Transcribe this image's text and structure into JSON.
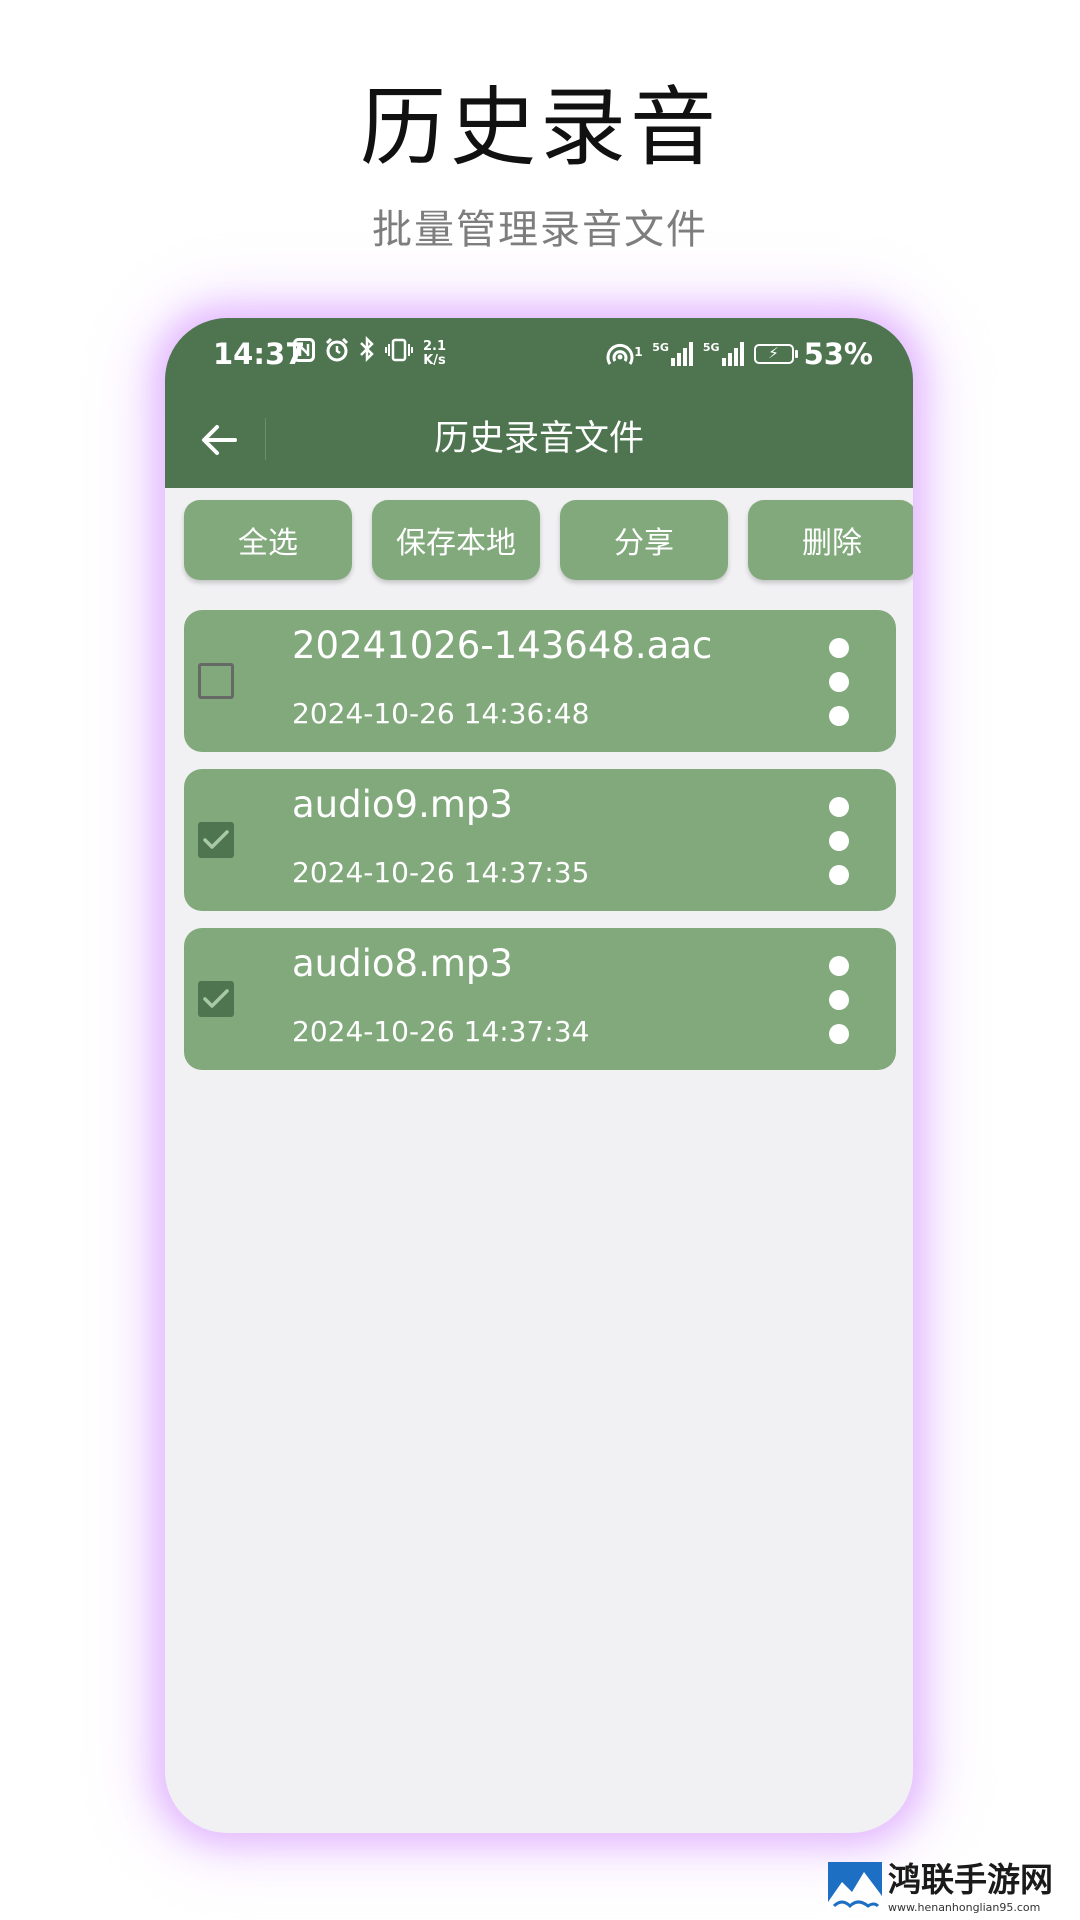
{
  "promo": {
    "title": "历史录音",
    "subtitle": "批量管理录音文件"
  },
  "status_bar": {
    "time": "14:37",
    "net_speed_value": "2.1",
    "net_speed_unit": "K/s",
    "left_icons": [
      "nfc-icon",
      "alarm-icon",
      "bluetooth-icon",
      "vibrate-icon"
    ],
    "hotspot_badge": "1",
    "sim1_label": "5G",
    "sim2_label": "5G",
    "battery_percent": "53%",
    "charging": true
  },
  "header": {
    "title": "历史录音文件",
    "back_icon": "arrow-left-icon",
    "background": "#4e7550"
  },
  "toolbar": {
    "buttons": [
      {
        "label": "全选"
      },
      {
        "label": "保存本地"
      },
      {
        "label": "分享"
      },
      {
        "label": "删除"
      }
    ]
  },
  "files": [
    {
      "name": "20241026-143648.aac",
      "time": "2024-10-26 14:36:48",
      "checked": false
    },
    {
      "name": "audio9.mp3",
      "time": "2024-10-26 14:37:35",
      "checked": true
    },
    {
      "name": "audio8.mp3",
      "time": "2024-10-26 14:37:34",
      "checked": true
    }
  ],
  "colors": {
    "accent": "#4e7550",
    "card": "#81a97c",
    "background": "#f1f0f3",
    "glow": "#d696ff"
  },
  "watermark": {
    "text": "鸿联手游网",
    "url": "www.henanhonglian95.com"
  }
}
